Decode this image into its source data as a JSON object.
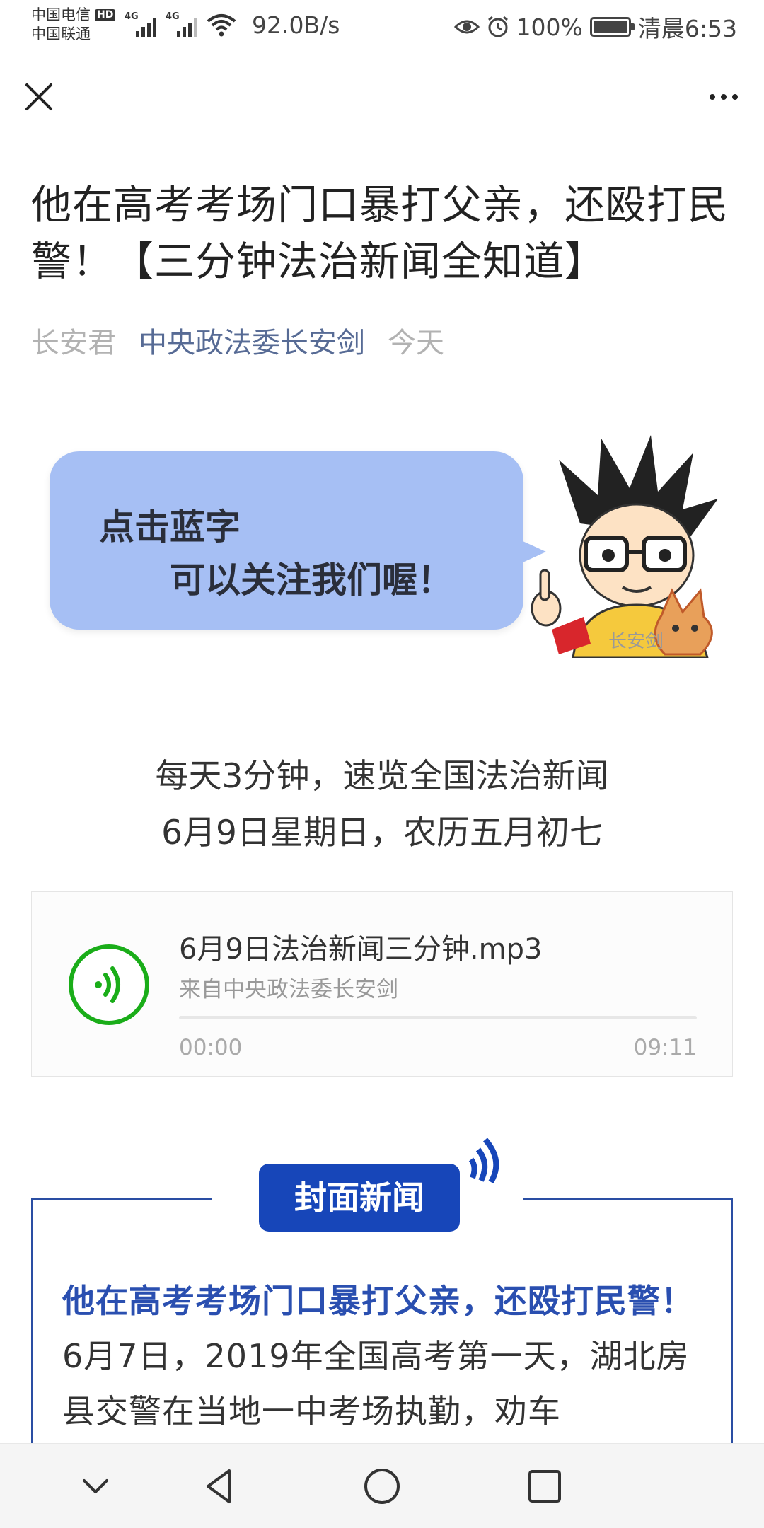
{
  "status_bar": {
    "carrier1": "中国电信",
    "carrier1_badge": "HD",
    "carrier2": "中国联通",
    "sig1_label": "4G",
    "sig2_label": "4G",
    "net_speed": "92.0B/s",
    "battery_pct": "100%",
    "time": "清晨6:53",
    "icons": [
      "eye-icon",
      "alarm-icon",
      "battery-icon",
      "wifi-icon",
      "signal-icon"
    ]
  },
  "top_nav": {
    "close_icon": "close-icon",
    "more_icon": "more-icon"
  },
  "article": {
    "title": "他在高考考场门口暴打父亲，还殴打民警！【三分钟法治新闻全知道】",
    "author": "长安君",
    "account": "中央政法委长安剑",
    "date": "今天"
  },
  "banner": {
    "line1": "点击蓝字",
    "line2": "可以关注我们喔！",
    "watermark": "长安剑"
  },
  "intro": {
    "line1": "每天3分钟，速览全国法治新闻",
    "line2": "6月9日星期日，农历五月初七"
  },
  "audio": {
    "title": "6月9日法治新闻三分钟.mp3",
    "source": "来自中央政法委长安剑",
    "time_start": "00:00",
    "time_end": "09:11",
    "progress": 0
  },
  "news": {
    "tag": "封面新闻",
    "headline": "他在高考考场门口暴打父亲，还殴打民警！",
    "body": "6月7日，2019年全国高考第一天，湖北房县交警在当地一中考场执勤，劝车"
  },
  "bottom_nav": {
    "icons": [
      "back-chevron-icon",
      "back-triangle-icon",
      "home-circle-icon",
      "recent-square-icon"
    ]
  }
}
